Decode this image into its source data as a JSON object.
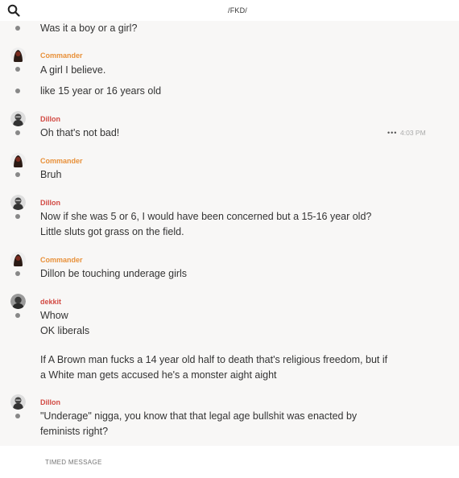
{
  "header": {
    "channel_name": "/FKD/"
  },
  "composer": {
    "placeholder": "TIMED MESSAGE"
  },
  "messages": [
    {
      "text": "Was it a boy or a girl?"
    },
    {
      "author": "Commander",
      "text": "A girl I believe."
    },
    {
      "text": "like 15 year or 16 years old"
    },
    {
      "author": "Dillon",
      "text": "Oh that's not bad!",
      "actions": "•••",
      "time": "4:03 PM"
    },
    {
      "author": "Commander",
      "text": "Bruh"
    },
    {
      "author": "Dillon",
      "lines": [
        "Now if she was 5 or 6, I would have been concerned but a 15-16 year old?",
        "Little sluts got grass on the field."
      ]
    },
    {
      "author": "Commander",
      "text": "Dillon be touching underage girls"
    },
    {
      "author": "dekkit",
      "lines": [
        "Whow",
        "OK liberals"
      ]
    },
    {
      "lines": [
        "If A Brown man fucks a 14 year old half to death that's religious freedom, but if",
        "a White man gets accused he's a monster aight aight"
      ]
    },
    {
      "author": "Dillon",
      "lines": [
        "\"Underage\" nigga, you know that that legal age bullshit was enacted by",
        "feminists right?"
      ]
    }
  ],
  "colors": {
    "author_orange": "#e8913a",
    "author_red": "#d24a43",
    "feed_background": "#f8f7f6"
  }
}
